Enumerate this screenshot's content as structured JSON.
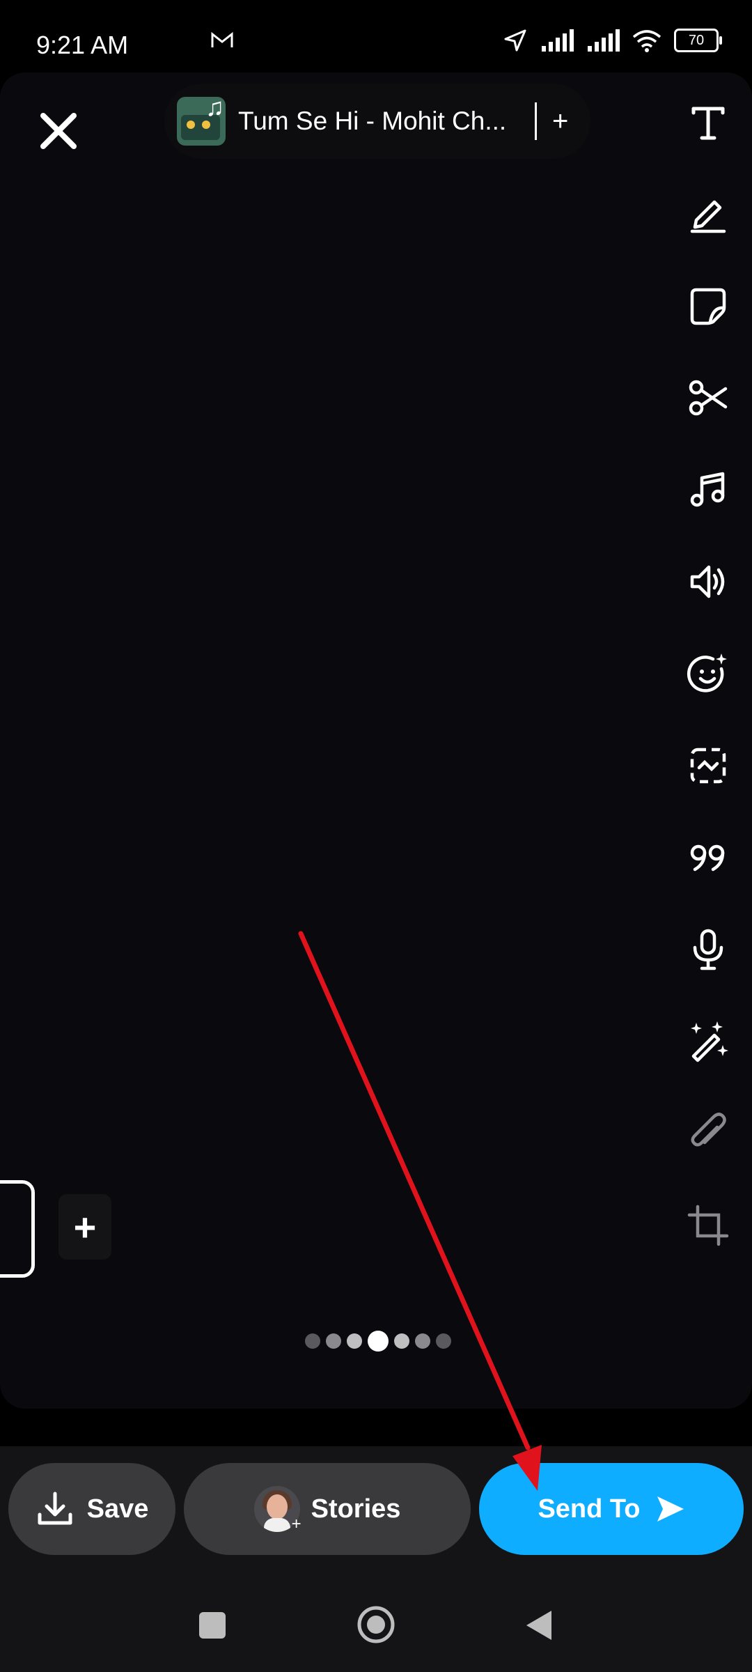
{
  "status_bar": {
    "time": "9:21 AM",
    "battery": "70"
  },
  "editor": {
    "close_icon": "close-icon",
    "music": {
      "title": "Tum Se Hi - Mohit Ch...",
      "add_label": "+"
    },
    "tools": [
      {
        "name": "text-tool-icon"
      },
      {
        "name": "draw-pen-icon"
      },
      {
        "name": "sticker-icon"
      },
      {
        "name": "scissors-icon"
      },
      {
        "name": "music-note-icon"
      },
      {
        "name": "volume-icon"
      },
      {
        "name": "lens-face-icon"
      },
      {
        "name": "scan-frame-icon"
      },
      {
        "name": "quote-icon"
      },
      {
        "name": "microphone-icon"
      },
      {
        "name": "magic-wand-icon"
      },
      {
        "name": "paperclip-icon"
      },
      {
        "name": "crop-icon"
      }
    ],
    "add_frame_label": "+",
    "page_indicator": {
      "count": 7,
      "active_index": 3
    }
  },
  "bottom_actions": {
    "save_label": "Save",
    "stories_label": "Stories",
    "send_label": "Send To",
    "send_color": "#0fadff"
  },
  "annotation": {
    "arrow_color": "#e0121c"
  }
}
